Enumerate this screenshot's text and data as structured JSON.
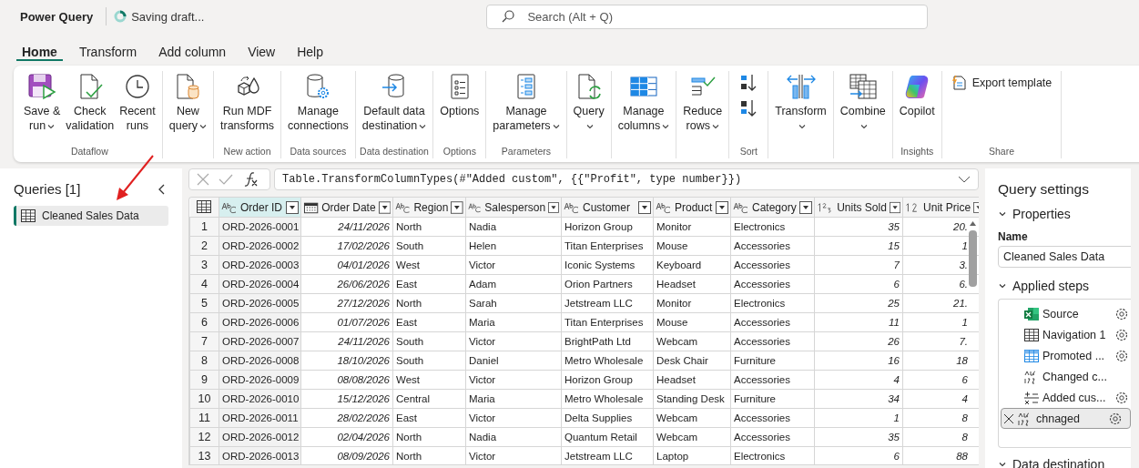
{
  "app": {
    "title": "Power Query",
    "status": "Saving draft..."
  },
  "search": {
    "placeholder": "Search (Alt + Q)"
  },
  "tabs": [
    {
      "label": "Home",
      "selected": true
    },
    {
      "label": "Transform",
      "selected": false
    },
    {
      "label": "Add column",
      "selected": false
    },
    {
      "label": "View",
      "selected": false
    },
    {
      "label": "Help",
      "selected": false
    }
  ],
  "ribbon": {
    "groups": [
      {
        "label": "Dataflow",
        "buttons": [
          {
            "kind": "large",
            "lines": [
              "Save &",
              "run"
            ],
            "dropdown": true
          },
          {
            "kind": "large",
            "lines": [
              "Check",
              "validation"
            ],
            "dropdown": false
          },
          {
            "kind": "large",
            "lines": [
              "Recent",
              "runs"
            ],
            "dropdown": false
          }
        ]
      },
      {
        "buttons": [
          {
            "kind": "large",
            "lines": [
              "New",
              "query"
            ],
            "dropdown": true
          }
        ]
      },
      {
        "label": "New action",
        "buttons": [
          {
            "kind": "large",
            "lines": [
              "Run MDF",
              "transforms"
            ],
            "dropdown": false
          }
        ]
      },
      {
        "label": "Data sources",
        "buttons": [
          {
            "kind": "large",
            "lines": [
              "Manage",
              "connections"
            ],
            "dropdown": false
          }
        ]
      },
      {
        "label": "Data destination",
        "buttons": [
          {
            "kind": "large",
            "lines": [
              "Default data",
              "destination"
            ],
            "dropdown": true
          }
        ]
      },
      {
        "label": "Options",
        "buttons": [
          {
            "kind": "large",
            "lines": [
              "Options"
            ],
            "dropdown": false
          }
        ]
      },
      {
        "label": "Parameters",
        "buttons": [
          {
            "kind": "large",
            "lines": [
              "Manage",
              "parameters"
            ],
            "dropdown": true
          }
        ]
      },
      {
        "buttons": [
          {
            "kind": "large",
            "lines": [
              "Query"
            ],
            "dropdown": true
          }
        ]
      },
      {
        "buttons": [
          {
            "kind": "large",
            "lines": [
              "Manage",
              "columns"
            ],
            "dropdown": true
          }
        ]
      },
      {
        "buttons": [
          {
            "kind": "large",
            "lines": [
              "Reduce",
              "rows"
            ],
            "dropdown": true
          }
        ]
      },
      {
        "label": "Sort",
        "buttons": [
          {
            "kind": "icon"
          },
          {
            "kind": "icon"
          }
        ]
      },
      {
        "buttons": [
          {
            "kind": "large",
            "lines": [
              "Transform"
            ],
            "dropdown": true
          }
        ]
      },
      {
        "buttons": [
          {
            "kind": "large",
            "lines": [
              "Combine"
            ],
            "dropdown": true
          }
        ]
      },
      {
        "label": "Insights",
        "buttons": [
          {
            "kind": "large",
            "lines": [
              "Copilot"
            ],
            "dropdown": false
          }
        ]
      },
      {
        "label": "Share",
        "buttons": [
          {
            "kind": "inline",
            "lines": [
              "Export template"
            ],
            "dropdown": false
          }
        ]
      }
    ]
  },
  "queries": {
    "title": "Queries [1]",
    "items": [
      {
        "label": "Cleaned Sales Data",
        "selected": true
      }
    ]
  },
  "formula": {
    "text": "Table.TransformColumnTypes(#\"Added custom\", {{\"Profit\", type number}})"
  },
  "table": {
    "columns": [
      {
        "label": "Order ID",
        "kind": "text",
        "selected": true
      },
      {
        "label": "Order Date",
        "kind": "date",
        "selected": false
      },
      {
        "label": "Region",
        "kind": "text",
        "selected": false
      },
      {
        "label": "Salesperson",
        "kind": "text",
        "selected": false
      },
      {
        "label": "Customer",
        "kind": "text",
        "selected": false
      },
      {
        "label": "Product",
        "kind": "text",
        "selected": false
      },
      {
        "label": "Category",
        "kind": "text",
        "selected": false
      },
      {
        "label": "Units Sold",
        "kind": "integer",
        "selected": false
      },
      {
        "label": "Unit Price",
        "kind": "decimal",
        "selected": false
      }
    ],
    "rows": [
      {
        "n": "1",
        "cells": [
          "ORD-2026-0001",
          "24/11/2026",
          "North",
          "Nadia",
          "Horizon Group",
          "Monitor",
          "Electronics",
          "35",
          "20."
        ]
      },
      {
        "n": "2",
        "cells": [
          "ORD-2026-0002",
          "17/02/2026",
          "South",
          "Helen",
          "Titan Enterprises",
          "Mouse",
          "Accessories",
          "15",
          "1"
        ]
      },
      {
        "n": "3",
        "cells": [
          "ORD-2026-0003",
          "04/01/2026",
          "West",
          "Victor",
          "Iconic Systems",
          "Keyboard",
          "Accessories",
          "7",
          "3."
        ]
      },
      {
        "n": "4",
        "cells": [
          "ORD-2026-0004",
          "26/06/2026",
          "East",
          "Adam",
          "Orion Partners",
          "Headset",
          "Accessories",
          "6",
          "6."
        ]
      },
      {
        "n": "5",
        "cells": [
          "ORD-2026-0005",
          "27/12/2026",
          "North",
          "Sarah",
          "Jetstream LLC",
          "Monitor",
          "Electronics",
          "25",
          "21."
        ]
      },
      {
        "n": "6",
        "cells": [
          "ORD-2026-0006",
          "01/07/2026",
          "East",
          "Maria",
          "Titan Enterprises",
          "Mouse",
          "Accessories",
          "11",
          "1"
        ]
      },
      {
        "n": "7",
        "cells": [
          "ORD-2026-0007",
          "24/11/2026",
          "South",
          "Victor",
          "BrightPath Ltd",
          "Webcam",
          "Accessories",
          "26",
          "7."
        ]
      },
      {
        "n": "8",
        "cells": [
          "ORD-2026-0008",
          "18/10/2026",
          "South",
          "Daniel",
          "Metro Wholesale",
          "Desk Chair",
          "Furniture",
          "16",
          "18"
        ]
      },
      {
        "n": "9",
        "cells": [
          "ORD-2026-0009",
          "08/08/2026",
          "West",
          "Victor",
          "Horizon Group",
          "Headset",
          "Accessories",
          "4",
          "6"
        ]
      },
      {
        "n": "10",
        "cells": [
          "ORD-2026-0010",
          "15/12/2026",
          "Central",
          "Maria",
          "Metro Wholesale",
          "Standing Desk",
          "Furniture",
          "34",
          "4"
        ]
      },
      {
        "n": "11",
        "cells": [
          "ORD-2026-0011",
          "28/02/2026",
          "East",
          "Victor",
          "Delta Supplies",
          "Webcam",
          "Accessories",
          "1",
          "8"
        ]
      },
      {
        "n": "12",
        "cells": [
          "ORD-2026-0012",
          "02/04/2026",
          "North",
          "Nadia",
          "Quantum Retail",
          "Webcam",
          "Accessories",
          "35",
          "8"
        ]
      },
      {
        "n": "13",
        "cells": [
          "ORD-2026-0013",
          "08/09/2026",
          "North",
          "Victor",
          "Jetstream LLC",
          "Laptop",
          "Electronics",
          "6",
          "88"
        ]
      }
    ]
  },
  "settings": {
    "title": "Query settings",
    "properties": {
      "label": "Properties",
      "expanded": true,
      "name_label": "Name",
      "name_value": "Cleaned Sales Data"
    },
    "steps_section": {
      "label": "Applied steps",
      "expanded": true
    },
    "steps": [
      {
        "label": "Source",
        "settings": true,
        "selected": false
      },
      {
        "label": "Navigation 1",
        "settings": true,
        "selected": false
      },
      {
        "label": "Promoted ...",
        "settings": true,
        "selected": false
      },
      {
        "label": "Changed c...",
        "settings": false,
        "selected": false
      },
      {
        "label": "Added cus...",
        "settings": true,
        "selected": false
      },
      {
        "label": "chnaged",
        "settings": true,
        "selected": true
      }
    ],
    "destination": {
      "label": "Data destination",
      "expanded": true
    }
  }
}
